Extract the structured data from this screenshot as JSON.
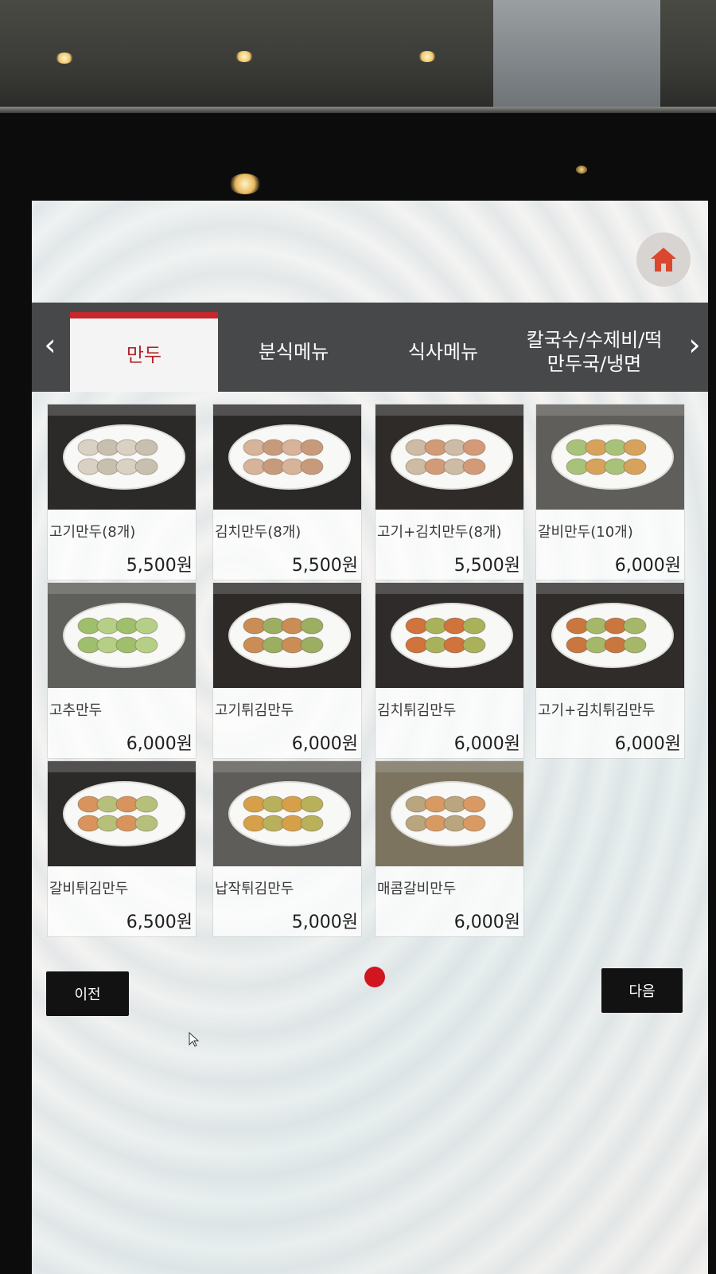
{
  "colors": {
    "accent": "#c8262d",
    "category_bar": "#46484a",
    "button_bg": "#121212",
    "page_dot": "#d0161f"
  },
  "header": {
    "home_icon": "home-icon"
  },
  "categories": {
    "prev_icon": "chevron-left-icon",
    "next_icon": "chevron-right-icon",
    "prev_glyph": "‹",
    "next_glyph": "›",
    "tabs": [
      {
        "label": "만두",
        "active": true
      },
      {
        "label": "분식메뉴",
        "active": false
      },
      {
        "label": "식사메뉴",
        "active": false
      },
      {
        "label_line1": "칼국수/수제비/떡",
        "label_line2": "만두국/냉면",
        "active": false
      }
    ]
  },
  "menu_items": [
    {
      "name": "고기만두(8개)",
      "price": "5,500원"
    },
    {
      "name": "김치만두(8개)",
      "price": "5,500원"
    },
    {
      "name": "고기+김치만두(8개)",
      "price": "5,500원"
    },
    {
      "name": "갈비만두(10개)",
      "price": "6,000원"
    },
    {
      "name": "고추만두",
      "price": "6,000원"
    },
    {
      "name": "고기튀김만두",
      "price": "6,000원"
    },
    {
      "name": "김치튀김만두",
      "price": "6,000원"
    },
    {
      "name": "고기+김치튀김만두",
      "price": "6,000원"
    },
    {
      "name": "갈비튀김만두",
      "price": "6,500원"
    },
    {
      "name": "납작튀김만두",
      "price": "5,000원"
    },
    {
      "name": "매콤갈비만두",
      "price": "6,000원"
    }
  ],
  "pagination": {
    "prev_label": "이전",
    "next_label": "다음",
    "current_page": 1
  }
}
